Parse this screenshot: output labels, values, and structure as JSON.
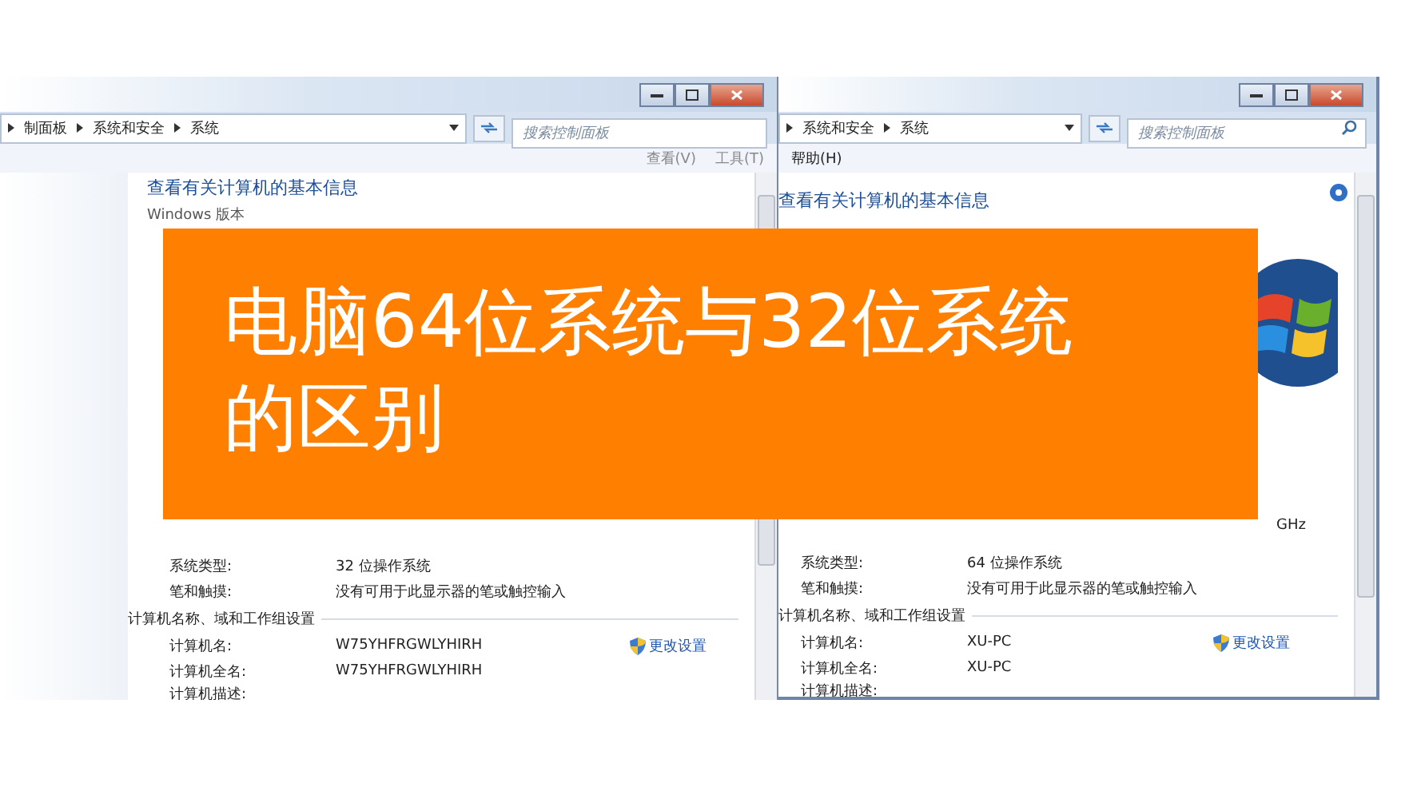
{
  "windows": [
    {
      "breadcrumb": [
        "制面板",
        "系统和安全",
        "系统"
      ],
      "search": {
        "placeholder": "搜索控制面板"
      },
      "menu": [
        "查看(V)",
        "工具(T)"
      ],
      "heading": "查看有关计算机的基本信息",
      "edition_label": "Windows 版本",
      "system_rows": [
        {
          "label": "系统类型:",
          "value": "32 位操作系统"
        },
        {
          "label": "笔和触摸:",
          "value": "没有可用于此显示器的笔或触控输入"
        }
      ],
      "section": "计算机名称、域和工作组设置",
      "name_rows": [
        {
          "label": "计算机名:",
          "value": "W75YHFRGWLYHIRH"
        },
        {
          "label": "计算机全名:",
          "value": "W75YHFRGWLYHIRH"
        },
        {
          "label": "计算机描述:",
          "value": ""
        }
      ],
      "change_link": "更改设置",
      "logo": false
    },
    {
      "breadcrumb": [
        "系统和安全",
        "系统"
      ],
      "search": {
        "placeholder": "搜索控制面板"
      },
      "menu": [
        "帮助(H)"
      ],
      "heading": "查看有关计算机的基本信息",
      "processor_tail": "GHz",
      "system_rows": [
        {
          "label": "系统类型:",
          "value": "64 位操作系统"
        },
        {
          "label": "笔和触摸:",
          "value": "没有可用于此显示器的笔或触控输入"
        }
      ],
      "section": "计算机名称、域和工作组设置",
      "name_rows": [
        {
          "label": "计算机名:",
          "value": "XU-PC"
        },
        {
          "label": "计算机全名:",
          "value": "XU-PC"
        },
        {
          "label": "计算机描述:",
          "value": ""
        }
      ],
      "change_link": "更改设置",
      "logo": true
    }
  ],
  "banner": {
    "lines": [
      "电脑64位系统与32位系统",
      "的区别"
    ]
  }
}
